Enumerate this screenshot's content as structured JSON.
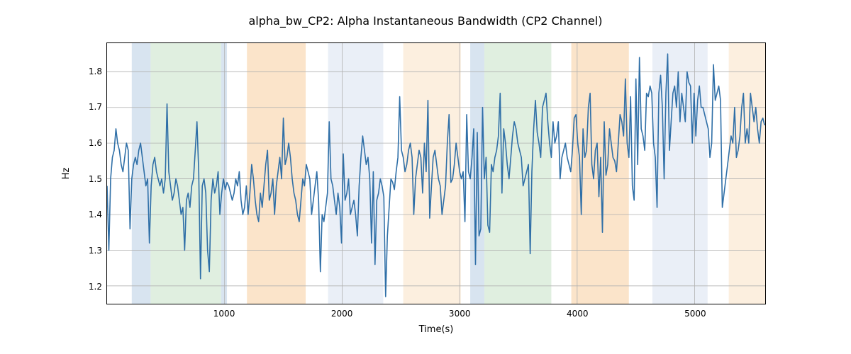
{
  "chart_data": {
    "type": "line",
    "title": "alpha_bw_CP2: Alpha Instantaneous Bandwidth (CP2 Channel)",
    "xlabel": "Time(s)",
    "ylabel": "Hz",
    "xlim": [
      0,
      5600
    ],
    "ylim": [
      1.15,
      1.88
    ],
    "x_ticks": [
      1000,
      2000,
      3000,
      4000,
      5000
    ],
    "y_ticks": [
      1.2,
      1.3,
      1.4,
      1.5,
      1.6,
      1.7,
      1.8
    ],
    "spans": [
      {
        "start": 210,
        "end": 370,
        "color": "#c3d6e8"
      },
      {
        "start": 370,
        "end": 970,
        "color": "#cfe7cf"
      },
      {
        "start": 970,
        "end": 1020,
        "color": "#c3d6e8"
      },
      {
        "start": 1190,
        "end": 1690,
        "color": "#f9d6ad"
      },
      {
        "start": 1880,
        "end": 2350,
        "color": "#dee7f2"
      },
      {
        "start": 2520,
        "end": 3010,
        "color": "#fbe6ce"
      },
      {
        "start": 3090,
        "end": 3210,
        "color": "#c3d6e8"
      },
      {
        "start": 3210,
        "end": 3780,
        "color": "#cfe7cf"
      },
      {
        "start": 3950,
        "end": 4440,
        "color": "#f9d6ad"
      },
      {
        "start": 4640,
        "end": 5110,
        "color": "#dee7f2"
      },
      {
        "start": 5290,
        "end": 5600,
        "color": "#fbe6ce"
      }
    ],
    "line_color": "#2f6fa7",
    "series": [
      {
        "name": "alpha_bw_CP2",
        "x_step": 15,
        "values": [
          1.48,
          1.3,
          1.5,
          1.56,
          1.58,
          1.64,
          1.6,
          1.58,
          1.54,
          1.52,
          1.56,
          1.6,
          1.58,
          1.36,
          1.5,
          1.54,
          1.56,
          1.54,
          1.58,
          1.6,
          1.56,
          1.52,
          1.48,
          1.5,
          1.32,
          1.48,
          1.54,
          1.56,
          1.52,
          1.5,
          1.48,
          1.5,
          1.46,
          1.5,
          1.71,
          1.52,
          1.48,
          1.44,
          1.46,
          1.5,
          1.48,
          1.44,
          1.4,
          1.42,
          1.3,
          1.44,
          1.46,
          1.42,
          1.48,
          1.5,
          1.58,
          1.66,
          1.52,
          1.22,
          1.48,
          1.5,
          1.46,
          1.3,
          1.24,
          1.44,
          1.5,
          1.46,
          1.48,
          1.52,
          1.4,
          1.46,
          1.5,
          1.47,
          1.49,
          1.48,
          1.46,
          1.44,
          1.46,
          1.5,
          1.48,
          1.52,
          1.44,
          1.4,
          1.42,
          1.48,
          1.4,
          1.46,
          1.54,
          1.5,
          1.44,
          1.4,
          1.38,
          1.46,
          1.42,
          1.48,
          1.54,
          1.58,
          1.44,
          1.46,
          1.5,
          1.4,
          1.48,
          1.52,
          1.56,
          1.5,
          1.67,
          1.54,
          1.56,
          1.6,
          1.56,
          1.5,
          1.46,
          1.44,
          1.4,
          1.38,
          1.44,
          1.5,
          1.48,
          1.54,
          1.52,
          1.5,
          1.4,
          1.44,
          1.48,
          1.52,
          1.44,
          1.24,
          1.4,
          1.38,
          1.42,
          1.46,
          1.66,
          1.5,
          1.48,
          1.44,
          1.4,
          1.46,
          1.42,
          1.32,
          1.57,
          1.44,
          1.46,
          1.5,
          1.4,
          1.42,
          1.44,
          1.4,
          1.34,
          1.48,
          1.56,
          1.62,
          1.58,
          1.54,
          1.56,
          1.5,
          1.32,
          1.52,
          1.26,
          1.44,
          1.46,
          1.5,
          1.48,
          1.45,
          1.17,
          1.34,
          1.42,
          1.5,
          1.49,
          1.47,
          1.52,
          1.56,
          1.73,
          1.58,
          1.56,
          1.52,
          1.54,
          1.58,
          1.6,
          1.56,
          1.4,
          1.5,
          1.54,
          1.58,
          1.56,
          1.46,
          1.6,
          1.52,
          1.72,
          1.39,
          1.48,
          1.56,
          1.58,
          1.54,
          1.5,
          1.48,
          1.4,
          1.44,
          1.48,
          1.6,
          1.68,
          1.49,
          1.5,
          1.54,
          1.6,
          1.56,
          1.52,
          1.5,
          1.52,
          1.38,
          1.68,
          1.52,
          1.5,
          1.56,
          1.64,
          1.26,
          1.63,
          1.34,
          1.36,
          1.7,
          1.5,
          1.56,
          1.37,
          1.35,
          1.54,
          1.52,
          1.56,
          1.58,
          1.62,
          1.74,
          1.46,
          1.64,
          1.6,
          1.54,
          1.5,
          1.56,
          1.62,
          1.66,
          1.64,
          1.6,
          1.58,
          1.56,
          1.48,
          1.5,
          1.52,
          1.54,
          1.29,
          1.52,
          1.64,
          1.72,
          1.63,
          1.6,
          1.56,
          1.7,
          1.72,
          1.74,
          1.66,
          1.6,
          1.56,
          1.66,
          1.6,
          1.62,
          1.66,
          1.5,
          1.56,
          1.58,
          1.6,
          1.56,
          1.54,
          1.52,
          1.58,
          1.67,
          1.68,
          1.6,
          1.56,
          1.4,
          1.64,
          1.56,
          1.58,
          1.7,
          1.74,
          1.54,
          1.5,
          1.58,
          1.6,
          1.45,
          1.56,
          1.35,
          1.66,
          1.51,
          1.54,
          1.64,
          1.6,
          1.56,
          1.55,
          1.52,
          1.6,
          1.68,
          1.66,
          1.62,
          1.78,
          1.6,
          1.56,
          1.73,
          1.48,
          1.44,
          1.78,
          1.54,
          1.84,
          1.64,
          1.62,
          1.58,
          1.74,
          1.73,
          1.76,
          1.74,
          1.6,
          1.56,
          1.42,
          1.74,
          1.79,
          1.7,
          1.5,
          1.74,
          1.85,
          1.58,
          1.66,
          1.74,
          1.76,
          1.7,
          1.8,
          1.66,
          1.74,
          1.7,
          1.66,
          1.8,
          1.77,
          1.76,
          1.6,
          1.74,
          1.62,
          1.72,
          1.76,
          1.7,
          1.7,
          1.68,
          1.66,
          1.64,
          1.56,
          1.6,
          1.82,
          1.72,
          1.74,
          1.76,
          1.72,
          1.42,
          1.46,
          1.5,
          1.54,
          1.58,
          1.62,
          1.6,
          1.7,
          1.56,
          1.58,
          1.62,
          1.7,
          1.74,
          1.6,
          1.64,
          1.6,
          1.74,
          1.7,
          1.66,
          1.7,
          1.64,
          1.6,
          1.66,
          1.67,
          1.65
        ]
      }
    ]
  }
}
